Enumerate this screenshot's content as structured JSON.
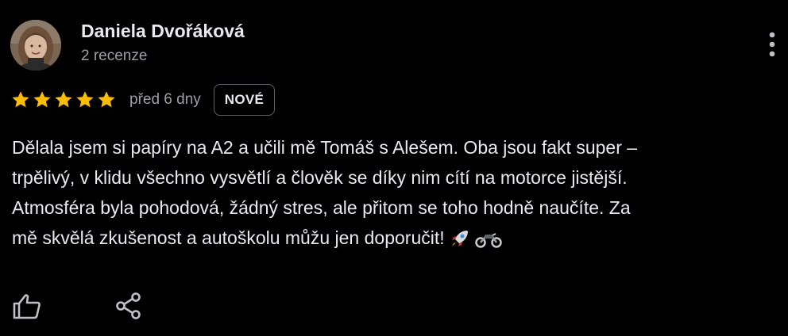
{
  "review": {
    "author": {
      "name": "Daniela Dvořáková",
      "meta": "2 recenze",
      "avatar_icon": "profile-photo"
    },
    "rating": {
      "stars": 5,
      "max_stars": 5,
      "star_color": "#fbbc04"
    },
    "date": "před 6 dny",
    "badge": "NOVÉ",
    "text_lines": [
      "Dělala jsem si papíry na A2 a učili mě Tomáš s Alešem. Oba jsou fakt super –",
      "trpělivý, v klidu všechno vysvětlí a člověk se díky nim cítí na motorce jistější.",
      "Atmosféra byla pohodová, žádný stres, ale přitom se toho hodně naučíte. Za",
      "mě skvělá zkušenost a autoškolu můžu jen doporučit!"
    ],
    "emojis": [
      "🚀",
      "🏍️"
    ]
  },
  "actions": {
    "like_icon": "thumbs-up-icon",
    "share_icon": "share-icon",
    "more_icon": "more-vert-icon"
  },
  "colors": {
    "background": "#000000",
    "text_primary": "#e8eaed",
    "text_secondary": "#9aa0a6",
    "badge_border": "#5f6368"
  }
}
